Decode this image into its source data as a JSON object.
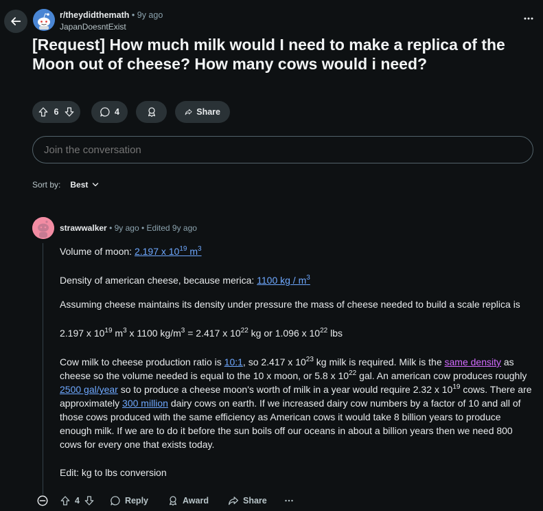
{
  "post": {
    "subreddit": "r/theydidthemath",
    "age": "9y ago",
    "author": "JapanDoesntExist",
    "title": "[Request] How much milk would I need to make a replica of the Moon out of cheese? How many cows would i need?",
    "votes": "6",
    "comments": "4",
    "share_label": "Share"
  },
  "join": {
    "placeholder": "Join the conversation"
  },
  "sort": {
    "label": "Sort by:",
    "value": "Best"
  },
  "comment": {
    "author": "strawwalker",
    "age": "9y ago",
    "edited": "Edited 9y ago",
    "p1_prefix": "Volume of moon: ",
    "p1_link_base": "2.197 x 10",
    "p1_link_exp": "19",
    "p1_link_unit": " m",
    "p1_link_unit_exp": "3",
    "p2_prefix": "Density of american cheese, because merica: ",
    "p2_link_base": "1100 kg / m",
    "p2_link_exp": "3",
    "p3": "Assuming cheese maintains its density under pressure the mass of cheese needed to build a scale replica is",
    "p4_a": "2.197 x 10",
    "p4_a_exp": "19",
    "p4_b": " m",
    "p4_b_exp": "3",
    "p4_c": " x 1100 kg/m",
    "p4_c_exp": "3",
    "p4_d": " = 2.417 x 10",
    "p4_d_exp": "22",
    "p4_e": " kg or 1.096 x 10",
    "p4_e_exp": "22",
    "p4_f": " lbs",
    "p5_a": "Cow milk to cheese production ratio is ",
    "p5_link1": "10:1",
    "p5_b": ", so 2.417 x 10",
    "p5_b_exp": "23",
    "p5_c": " kg milk is required. Milk is the ",
    "p5_link2": "same density",
    "p5_d": " as cheese so the volume needed is equal to the 10 x moon, or 5.8 x 10",
    "p5_d_exp": "22",
    "p5_e": " gal. An american cow produces roughly ",
    "p5_link3": "2500 gal/year",
    "p5_f": " so to produce a cheese moon's worth of milk in a year would require 2.32 x 10",
    "p5_f_exp": "19",
    "p5_g": " cows. There are approximately ",
    "p5_link4": "300 million",
    "p5_h": " dairy cows on earth. If we increased dairy cow numbers by a factor of 10 and all of those cows produced with the same efficiency as American cows it would take 8 billion years to produce enough milk. If we are to do it before the sun boils off our oceans in about a billion years then we need 800 cows for every one that exists today.",
    "p6": "Edit: kg to lbs conversion",
    "votes": "4",
    "reply_label": "Reply",
    "award_label": "Award",
    "share_label": "Share"
  },
  "colors": {
    "background": "#0e1113",
    "pill": "#2a3236",
    "link": "#6ea8ff",
    "visited_link": "#d26bff"
  },
  "icons": [
    "back-arrow-icon",
    "more-icon",
    "upvote-icon",
    "downvote-icon",
    "comment-icon",
    "award-icon",
    "share-icon",
    "chevron-down-icon",
    "collapse-icon"
  ]
}
